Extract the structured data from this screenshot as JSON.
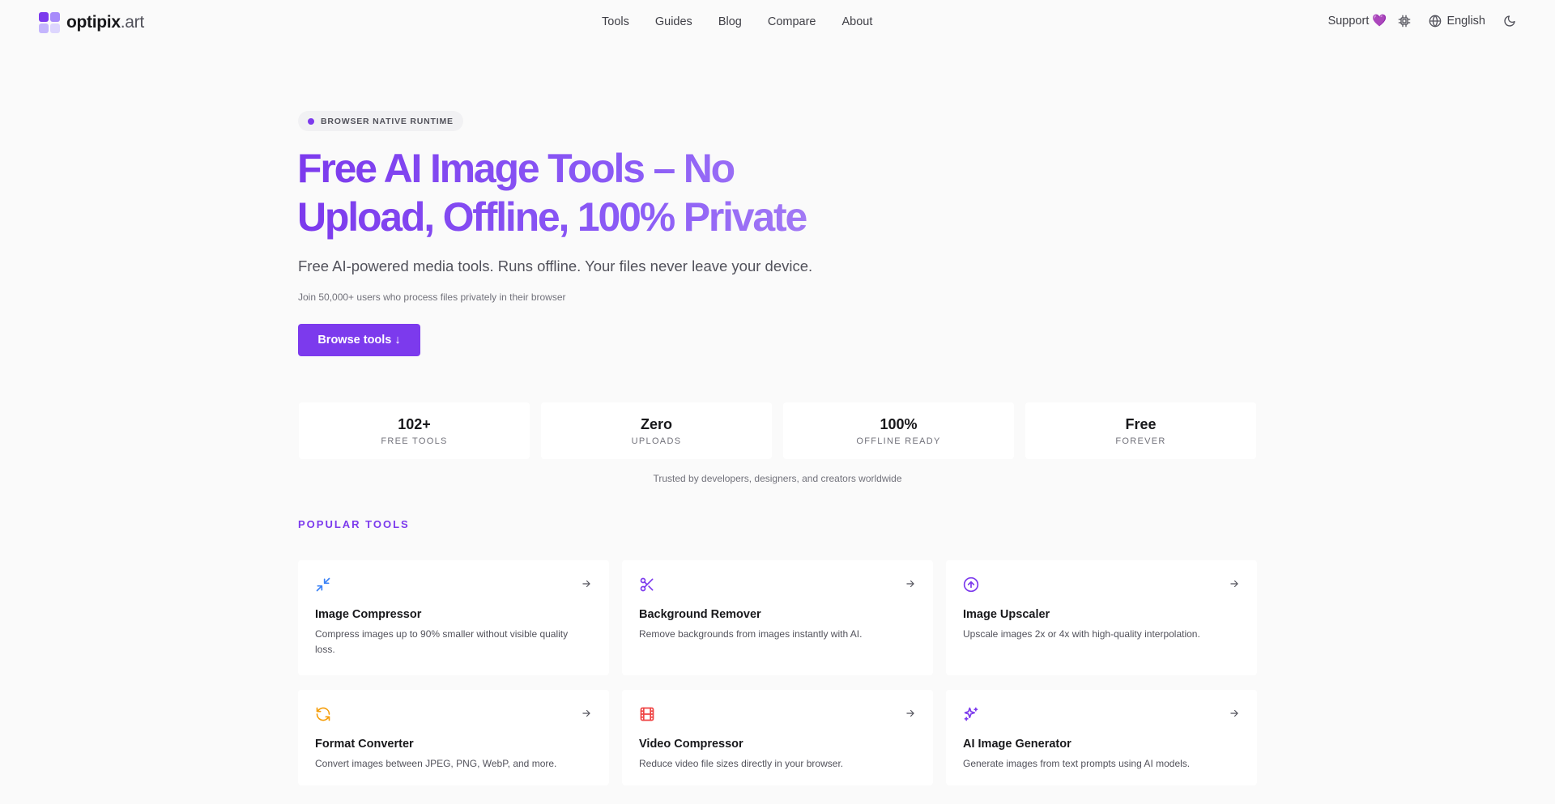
{
  "brand": {
    "name_bold": "optipix",
    "name_light": ".art",
    "logo_colors": [
      "#7c3aed",
      "#a78bfa",
      "#c4b5fd",
      "#ddd6fe"
    ]
  },
  "nav": {
    "items": [
      {
        "label": "Tools"
      },
      {
        "label": "Guides"
      },
      {
        "label": "Blog"
      },
      {
        "label": "Compare"
      },
      {
        "label": "About"
      }
    ]
  },
  "header_right": {
    "support_label": "Support 💜",
    "chip_icon": "cpu-icon",
    "language_label": "English",
    "globe_icon": "globe-icon",
    "theme_icon": "moon-icon"
  },
  "hero": {
    "badge": "BROWSER NATIVE RUNTIME",
    "title_line1": "Free AI Image Tools – No",
    "title_line2": "Upload, Offline, 100% Private",
    "subtitle": "Free AI-powered media tools. Runs offline. Your files never leave your device.",
    "note": "Join 50,000+ users who process files privately in their browser",
    "cta_label": "Browse tools ↓"
  },
  "stats": [
    {
      "value": "102+",
      "label": "FREE TOOLS"
    },
    {
      "value": "Zero",
      "label": "UPLOADS"
    },
    {
      "value": "100%",
      "label": "OFFLINE READY"
    },
    {
      "value": "Free",
      "label": "FOREVER"
    }
  ],
  "trusted": "Trusted by developers, designers, and creators worldwide",
  "popular": {
    "title": "POPULAR TOOLS",
    "tools": [
      {
        "name": "Image Compressor",
        "desc": "Compress images up to 90% smaller without visible quality loss.",
        "icon": "minimize-arrows-icon",
        "color": "#3b82f6"
      },
      {
        "name": "Background Remover",
        "desc": "Remove backgrounds from images instantly with AI.",
        "icon": "scissors-icon",
        "color": "#7c3aed"
      },
      {
        "name": "Image Upscaler",
        "desc": "Upscale images 2x or 4x with high-quality interpolation.",
        "icon": "circle-arrow-up-icon",
        "color": "#7c3aed"
      },
      {
        "name": "Format Converter",
        "desc": "Convert images between JPEG, PNG, WebP, and more.",
        "icon": "refresh-icon",
        "color": "#f59e0b"
      },
      {
        "name": "Video Compressor",
        "desc": "Reduce video file sizes directly in your browser.",
        "icon": "film-icon",
        "color": "#ef4444"
      },
      {
        "name": "AI Image Generator",
        "desc": "Generate images from text prompts using AI models.",
        "icon": "sparkles-icon",
        "color": "#7c3aed"
      }
    ]
  }
}
